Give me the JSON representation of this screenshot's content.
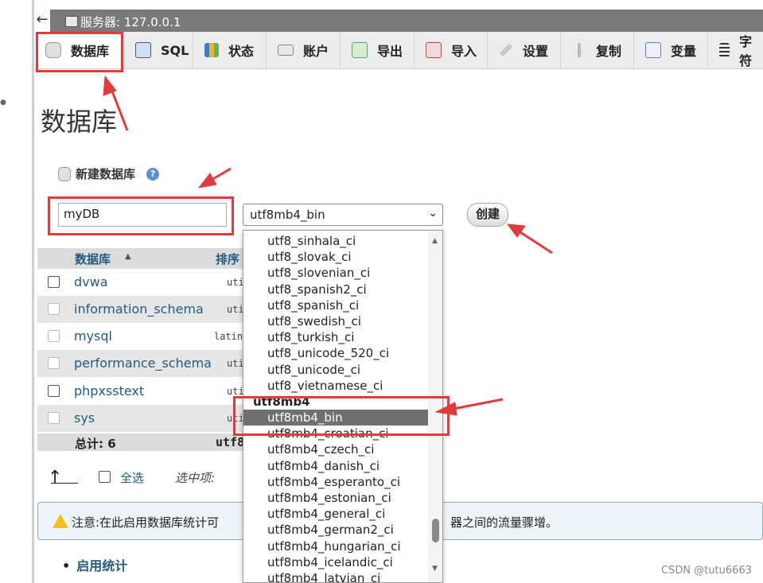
{
  "topbar": {
    "back": "←",
    "server_label": "服务器: 127.0.0.1"
  },
  "tabs": [
    {
      "label": "数据库",
      "icon": "database-icon",
      "active": true
    },
    {
      "label": "SQL",
      "icon": "sql-icon"
    },
    {
      "label": "状态",
      "icon": "status-chart-icon"
    },
    {
      "label": "账户",
      "icon": "accounts-icon"
    },
    {
      "label": "导出",
      "icon": "export-icon"
    },
    {
      "label": "导入",
      "icon": "import-icon"
    },
    {
      "label": "设置",
      "icon": "wrench-icon"
    },
    {
      "label": "复制",
      "icon": "replication-icon"
    },
    {
      "label": "变量",
      "icon": "variables-icon"
    },
    {
      "label": "字符",
      "icon": "charset-icon"
    }
  ],
  "page_title": "数据库",
  "create": {
    "heading": "新建数据库",
    "help": "?",
    "db_name_value": "myDB",
    "collation_value": "utf8mb4_bin",
    "button": "创建"
  },
  "table": {
    "headers": {
      "name": "数据库",
      "collation": "排序"
    },
    "rows": [
      {
        "name": "dvwa",
        "collation": "uti"
      },
      {
        "name": "information_schema",
        "collation": "uti"
      },
      {
        "name": "mysql",
        "collation": "latin"
      },
      {
        "name": "performance_schema",
        "collation": "uti"
      },
      {
        "name": "phpxsstext",
        "collation": "uti"
      },
      {
        "name": "sys",
        "collation": "uti"
      }
    ],
    "total_label": "总计: 6",
    "total_collation": "utf8"
  },
  "bulk": {
    "arrow": "↑",
    "select_all": "全选",
    "with_selected": "选中项:"
  },
  "notice": {
    "left": "注意:在此启用数据库统计可",
    "right": "器之间的流量骤增。"
  },
  "enable_stats": "启用统计",
  "dropdown": {
    "options_before": [
      "utf8_sinhala_ci",
      "utf8_slovak_ci",
      "utf8_slovenian_ci",
      "utf8_spanish2_ci",
      "utf8_spanish_ci",
      "utf8_swedish_ci",
      "utf8_turkish_ci",
      "utf8_unicode_520_ci",
      "utf8_unicode_ci",
      "utf8_vietnamese_ci"
    ],
    "group": "utf8mb4",
    "selected": "utf8mb4_bin",
    "options_after": [
      "utf8mb4_croatian_ci",
      "utf8mb4_czech_ci",
      "utf8mb4_danish_ci",
      "utf8mb4_esperanto_ci",
      "utf8mb4_estonian_ci",
      "utf8mb4_general_ci",
      "utf8mb4_german2_ci",
      "utf8mb4_hungarian_ci",
      "utf8mb4_icelandic_ci",
      "utf8mb4_latvian_ci"
    ]
  },
  "watermark": "CSDN @tutu6663",
  "colors": {
    "annotation_red": "#e23b3b",
    "link_blue": "#235a81",
    "topbar_gray": "#7a7a7a"
  }
}
